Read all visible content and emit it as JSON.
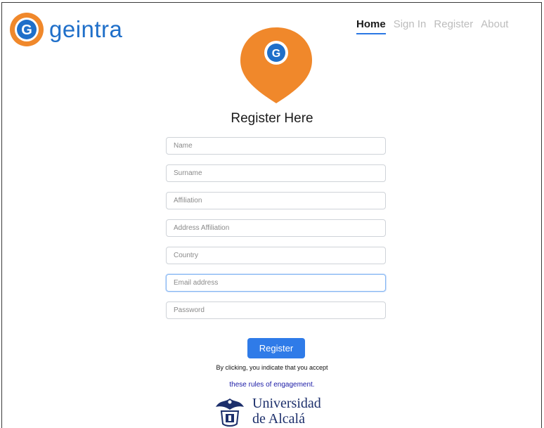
{
  "brand": {
    "name": "geintra",
    "mark_letter": "G",
    "colors": {
      "orange": "#f0882b",
      "blue": "#1f6fc9"
    }
  },
  "nav": {
    "items": [
      {
        "label": "Home",
        "active": true
      },
      {
        "label": "Sign In",
        "active": false
      },
      {
        "label": "Register",
        "active": false
      },
      {
        "label": "About",
        "active": false
      }
    ]
  },
  "form": {
    "heading": "Register Here",
    "fields": [
      {
        "placeholder": "Name",
        "value": ""
      },
      {
        "placeholder": "Surname",
        "value": ""
      },
      {
        "placeholder": "Affiliation",
        "value": ""
      },
      {
        "placeholder": "Address Affiliation",
        "value": ""
      },
      {
        "placeholder": "Country",
        "value": ""
      },
      {
        "placeholder": "Email address",
        "value": "",
        "focused": true
      },
      {
        "placeholder": "Password",
        "value": ""
      }
    ],
    "submit_label": "Register",
    "consent_text": "By clicking, you indicate that you accept",
    "rules_link": "these rules of engagement."
  },
  "footer": {
    "university_line1": "Universidad",
    "university_line2": "de Alcalá"
  }
}
